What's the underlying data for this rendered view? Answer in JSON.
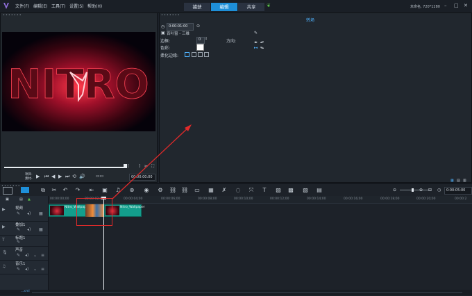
{
  "menubar": {
    "items": [
      "文件(F)",
      "编辑(E)",
      "工具(T)",
      "设置(S)",
      "帮助(H)"
    ],
    "tabs": [
      "捕获",
      "编辑",
      "共享"
    ],
    "active_tab": "编辑",
    "project_info": "未命名, 720*1280",
    "window_controls": [
      "–",
      "□",
      "✕"
    ]
  },
  "options_panel": {
    "title": "转场",
    "timecode": "0:00:01:00",
    "border_label": "边框:",
    "border_value": "0",
    "color_label": "色彩:",
    "color_value": "#ffffff",
    "soften_label": "柔化边缘:",
    "direction_label": "方向:",
    "preset_label": "百叶窗 - 三维"
  },
  "preview": {
    "project_label": "项目-",
    "clip_label": "素材-",
    "timecode": "00:00:00:00",
    "logo_text": "NITRO"
  },
  "timeline": {
    "ruler_labels": [
      "00:00:00;00",
      "00:00:02;00",
      "00:00:04;00",
      "00:00:06;00",
      "00:00:08;00",
      "00:00:10;00",
      "00:00:12;00",
      "00:00:14;00",
      "00:00:16;00",
      "00:00:18;00",
      "00:00:20;00",
      "00:00:2"
    ],
    "duration": "0:00:05:00",
    "tracks": [
      {
        "name": "视频",
        "icon": "video-icon"
      },
      {
        "name": "叠加1",
        "icon": "overlay-icon"
      },
      {
        "name": "标题1",
        "icon": "title-icon"
      },
      {
        "name": "声音",
        "icon": "voice-icon"
      },
      {
        "name": "音乐1",
        "icon": "music-icon"
      }
    ],
    "clips": [
      {
        "label": "Nitro_Wallpaper",
        "track": "视频"
      },
      {
        "label": "Nitro_Wallpaper",
        "track": "视频"
      }
    ]
  },
  "status": {
    "text": "...xml"
  },
  "colors": {
    "accent": "#1e8fd8",
    "clip": "#139e8c",
    "annotation": "#e02a2a"
  }
}
